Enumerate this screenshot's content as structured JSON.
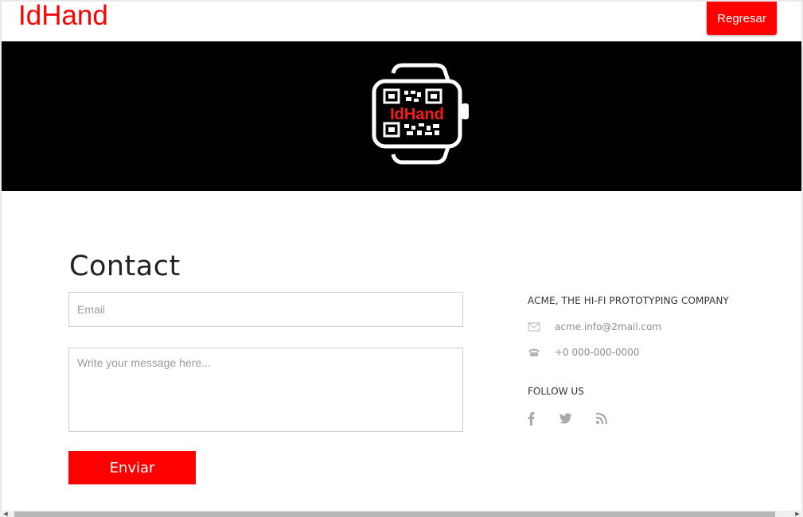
{
  "header": {
    "brand": "IdHand",
    "back_button": "Regresar"
  },
  "banner": {
    "logo_text": "IdHand"
  },
  "contact": {
    "title": "Contact",
    "email_placeholder": "Email",
    "message_placeholder": "Write your message here...",
    "send_button": "Enviar"
  },
  "sidebar": {
    "company": "ACME, THE HI-FI PROTOTYPING COMPANY",
    "email": "acme.info@2mail.com",
    "phone": "+0 000-000-0000",
    "follow_label": "FOLLOW US",
    "social_icons": [
      "facebook-icon",
      "twitter-icon",
      "rss-icon"
    ]
  },
  "colors": {
    "accent": "#ff0000",
    "banner_bg": "#000000",
    "muted_text": "#8c8c8c"
  }
}
